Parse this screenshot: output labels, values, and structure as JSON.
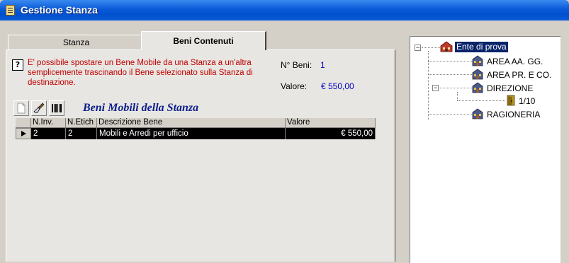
{
  "window": {
    "title": "Gestione Stanza"
  },
  "tabs": [
    {
      "label": "Stanza",
      "active": false
    },
    {
      "label": "Beni Contenuti",
      "active": true
    }
  ],
  "help": {
    "text": "E' possibile spostare un Bene Mobile da una Stanza a un'altra semplicemente trascinando il Bene selezionato sulla Stanza di destinazione."
  },
  "stats": {
    "n_beni_label": "N° Beni:",
    "n_beni_value": "1",
    "valore_label": "Valore:",
    "valore_value": "€ 550,00"
  },
  "toolbar": {
    "buttons": [
      "new-document-icon",
      "brush-icon",
      "barcode-icon"
    ],
    "title": "Beni Mobili della Stanza"
  },
  "grid": {
    "columns": [
      "N.Inv.",
      "N.Etich",
      "Descrizione Bene",
      "Valore"
    ],
    "rows": [
      {
        "n_inv": "2",
        "n_etich": "2",
        "descrizione": "Mobili e Arredi per ufficio",
        "valore": "€ 550,00",
        "selected": true
      }
    ]
  },
  "tree": {
    "root": {
      "label": "Ente di prova",
      "icon": "building-icon",
      "selected": true
    },
    "children": [
      {
        "label": "AREA AA. GG.",
        "icon": "building-icon"
      },
      {
        "label": "AREA PR. E CO.",
        "icon": "building-icon"
      },
      {
        "label": "DIREZIONE",
        "icon": "building-icon",
        "expanded": true,
        "children": [
          {
            "label": "1/10",
            "icon": "door-icon"
          }
        ]
      },
      {
        "label": "RAGIONERIA",
        "icon": "building-icon"
      }
    ]
  },
  "colors": {
    "titlebar": "#0a5ad8",
    "help_text": "#c00000",
    "value_text": "#0000c0",
    "grid_title": "#0a1e8c",
    "selection": "#0a246a"
  }
}
